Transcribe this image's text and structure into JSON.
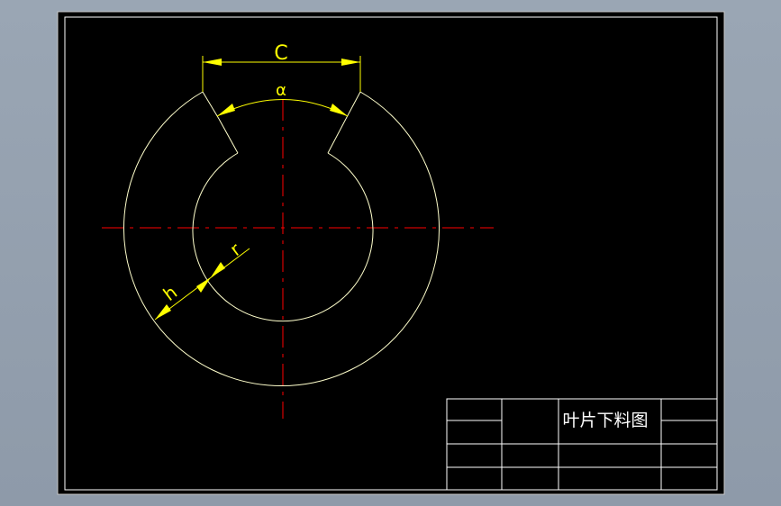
{
  "drawing": {
    "title": "叶片下料图",
    "dimensions": {
      "chord_label": "C",
      "angle_label": "α",
      "inner_radius_label": "r",
      "width_label": "h"
    }
  },
  "colors": {
    "background": "#000000",
    "frame": "#ffffff",
    "outline": "#ffff99",
    "dimension": "#ffff00",
    "centerline": "#ff0000",
    "table_lines": "#ffffff"
  }
}
